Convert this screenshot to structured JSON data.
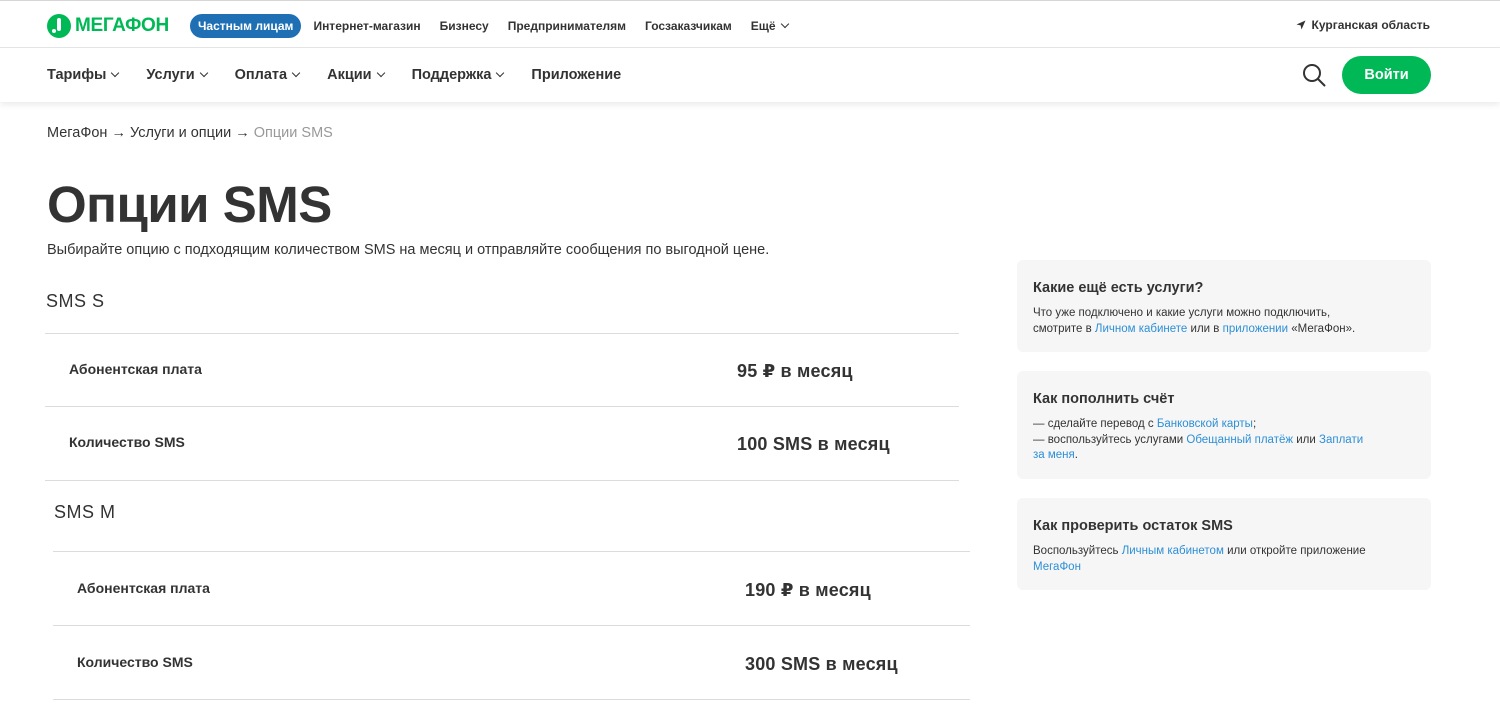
{
  "brand": {
    "name": "МЕГАФОН",
    "color": "#00b956",
    "accent": "#1f6fb4"
  },
  "topbar": {
    "segments": [
      "Частным лицам",
      "Интернет-магазин",
      "Бизнесу",
      "Предпринимателям",
      "Госзаказчикам",
      "Ещё"
    ],
    "region": "Курганская область"
  },
  "nav": {
    "items": [
      "Тарифы",
      "Услуги",
      "Оплата",
      "Акции",
      "Поддержка",
      "Приложение"
    ],
    "login": "Войти"
  },
  "breadcrumb": {
    "home": "МегаФон",
    "sep1": "→",
    "section": "Услуги и опции",
    "sep2": "→",
    "current": "Опции SMS"
  },
  "page": {
    "title": "Опции SMS",
    "subtitle": "Выбирайте опцию с подходящим количеством SMS на месяц и отправляйте сообщения по выгодной цене."
  },
  "options": [
    {
      "name": "SMS S",
      "rows": [
        {
          "label": "Абонентская плата",
          "value": "95 ₽ в месяц"
        },
        {
          "label": "Количество SMS",
          "value": "100 SMS в месяц"
        }
      ]
    },
    {
      "name": "SMS M",
      "rows": [
        {
          "label": "Абонентская плата",
          "value": "190 ₽ в месяц"
        },
        {
          "label": "Количество SMS",
          "value": "300 SMS в месяц"
        }
      ]
    }
  ],
  "cards": [
    {
      "title": "Какие ещё есть услуги?",
      "t1": "Что уже подключено и какие услуги можно подключить,",
      "t2": "смотрите в ",
      "l1": "Личном кабинете",
      "t3": " или в ",
      "l2": "приложении",
      "t4": " «МегаФон»."
    },
    {
      "title": "Как пополнить счёт",
      "t1": "— сделайте перевод с ",
      "l1": "Банковской карты",
      "t2": ";",
      "t3": "— воспользуйтесь услугами ",
      "l2": "Обещанный платёж",
      "t4": " или ",
      "l3": "Заплати",
      "l4": "за меня",
      "t5": "."
    },
    {
      "title": "Как проверить остаток SMS",
      "t1": "Воспользуйтесь ",
      "l1": "Личным кабинетом",
      "t2": " или откройте приложение",
      "l2": "МегаФон"
    }
  ]
}
